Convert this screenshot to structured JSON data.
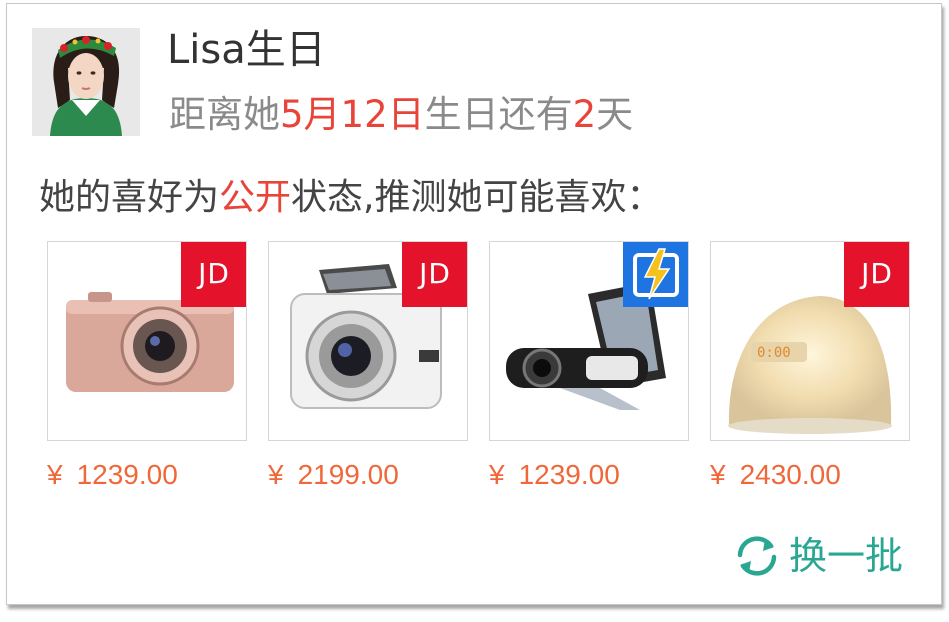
{
  "profile": {
    "name": "Lisa生日",
    "countdown": {
      "prefix": "距离她",
      "date": "5月12日",
      "middle": "生日还有",
      "days": "2",
      "suffix": "天"
    }
  },
  "preferences": {
    "prefix": "她的喜好为",
    "state": "公开",
    "suffix": "状态,推测她可能喜欢："
  },
  "products": [
    {
      "store": "JD",
      "store_icon": "jd-badge",
      "currency": "¥",
      "price": "1239.00",
      "item_icon": "pink-compact-camera"
    },
    {
      "store": "JD",
      "store_icon": "jd-badge",
      "currency": "¥",
      "price": "2199.00",
      "item_icon": "white-compact-camera"
    },
    {
      "store": "",
      "store_icon": "flash-store-badge",
      "currency": "¥",
      "price": "1239.00",
      "item_icon": "flip-screen-camcorder"
    },
    {
      "store": "JD",
      "store_icon": "jd-badge",
      "currency": "¥",
      "price": "2430.00",
      "item_icon": "wake-up-light-lamp"
    }
  ],
  "actions": {
    "refresh_label": "换一批",
    "refresh_icon": "refresh-icon"
  },
  "colors": {
    "highlight": "#e8443a",
    "price": "#f0683a",
    "jd_badge": "#e4122a",
    "flash_badge": "#1e74e0",
    "refresh": "#2aa793"
  }
}
